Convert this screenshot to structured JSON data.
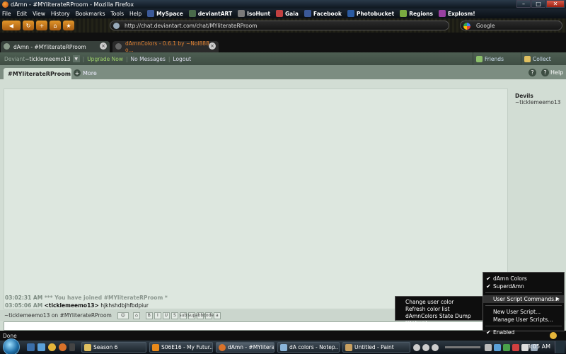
{
  "window": {
    "title": "dAmn - #MYliterateRProom - Mozilla Firefox",
    "controls": [
      "–",
      "□",
      "✕"
    ]
  },
  "menubar": {
    "menus": [
      "File",
      "Edit",
      "View",
      "History",
      "Bookmarks",
      "Tools",
      "Help"
    ],
    "bookmarks": [
      {
        "label": "MySpace",
        "color": "#3b5998"
      },
      {
        "label": "deviantART",
        "color": "#4a6b4a"
      },
      {
        "label": "IsoHunt",
        "color": "#7a7a7a"
      },
      {
        "label": "Gaia",
        "color": "#c04040"
      },
      {
        "label": "Facebook",
        "color": "#3b5998"
      },
      {
        "label": "Photobucket",
        "color": "#2a5aa0"
      },
      {
        "label": "Regions",
        "color": "#7aaa40"
      },
      {
        "label": "Explosm!",
        "color": "#9a40a0"
      }
    ]
  },
  "navbar": {
    "url": "http://chat.deviantart.com/chat/MYliterateRProom",
    "search_placeholder": "Google"
  },
  "tabs": [
    {
      "label": "dAmn - #MYliterateRProom",
      "active": true
    },
    {
      "label": "dAmnColors - 0.6.1 by ~Nol888 o...",
      "active": false
    }
  ],
  "dabar": {
    "deviant_label": "Deviant",
    "username": "~ticklemeemo13",
    "upgrade": "Upgrade Now",
    "messages": "No Messages",
    "logout": "Logout",
    "friends": "Friends",
    "collect": "Collect"
  },
  "chat": {
    "room_tab": "#MYliterateRProom",
    "more": "More",
    "help": "Help",
    "members": {
      "group": "Devils",
      "users": [
        "~ticklemeemo13"
      ]
    },
    "messages": [
      {
        "time": "03:02:31 AM",
        "text": "*** You have joined #MYliterateRProom *"
      },
      {
        "time": "03:05:06 AM",
        "nick": "<ticklemeemo13>",
        "text": "hjkhshdbjhfbdpiur"
      }
    ],
    "input_label": "~ticklemeemo13 on #MYliterateRProom",
    "format_buttons": [
      "B",
      "I",
      "U",
      "S",
      "sub",
      "sup",
      "abbr",
      "code",
      "a"
    ]
  },
  "status": {
    "text": "Done"
  },
  "submenu": {
    "items": [
      "Change user color",
      "Refresh color list",
      "dAmnColors State Dump [Debug]"
    ]
  },
  "context_menu": {
    "items": [
      {
        "label": "dAmn Colors",
        "checked": true
      },
      {
        "label": "SuperdAmn",
        "checked": true
      },
      {
        "label": "User Script Commands...",
        "submenu": true,
        "highlight": true
      },
      {
        "label": "New User Script..."
      },
      {
        "label": "Manage User Scripts..."
      },
      {
        "label": "Enabled",
        "checked": true
      }
    ]
  },
  "taskbar": {
    "tasks": [
      "Season 6",
      "S06E16 - My Futur...",
      "dAmn - #MYlitera...",
      "dA colors - Notep...",
      "Untitled - Paint"
    ],
    "clock": "3:05 AM"
  }
}
